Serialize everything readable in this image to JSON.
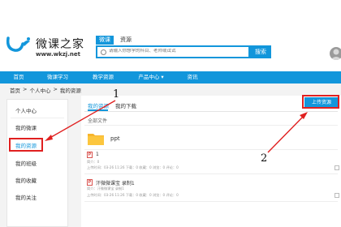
{
  "brand": {
    "title": "微课之家",
    "url": "www.wkzj.net"
  },
  "search": {
    "tabs": [
      {
        "label": "微课",
        "active": true
      },
      {
        "label": "资源",
        "active": false
      }
    ],
    "placeholder": "请输入你想学的科目、老师或试试",
    "button": "搜索"
  },
  "nav": {
    "items": [
      "首页",
      "微课学习",
      "教学资源",
      "产品中心 ▾",
      "资讯"
    ]
  },
  "breadcrumb": {
    "items": [
      "首页",
      ">",
      "个人中心",
      ">",
      "我的资源"
    ]
  },
  "sidebar": {
    "items": [
      {
        "label": "个人中心",
        "active": false
      },
      {
        "label": "我的微课",
        "active": false
      },
      {
        "label": "我的资源",
        "active": true
      },
      {
        "label": "我的班级",
        "active": false
      },
      {
        "label": "我的收藏",
        "active": false
      },
      {
        "label": "我的关注",
        "active": false
      }
    ]
  },
  "main": {
    "tabs": [
      {
        "label": "我的资源",
        "active": true
      },
      {
        "label": "我的下载",
        "active": false
      }
    ],
    "upload_button": "上传资源",
    "all_files": "全部文件",
    "folder": {
      "name": "ppt"
    },
    "files": [
      {
        "title": "1",
        "meta1": "简介：0",
        "meta2": "上传时间：03-26 11:26  下载：0  收藏：0  浏览：0  评论：0"
      },
      {
        "title": "汗微微课宝 录制1",
        "meta1": "简介：汗微微课宝 录制1",
        "meta2": "上传时间：03-26 11:26  下载：0  收藏：0  浏览：0  评论：0"
      }
    ]
  },
  "annotations": {
    "num1": "1",
    "num2": "2"
  },
  "colors": {
    "accent": "#1296db",
    "annotation": "#e02020"
  }
}
